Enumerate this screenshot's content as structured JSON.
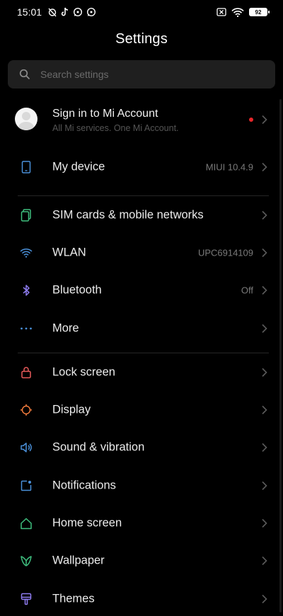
{
  "status_bar": {
    "time": "15:01",
    "battery_level": "92"
  },
  "header": {
    "title": "Settings"
  },
  "search": {
    "placeholder": "Search settings"
  },
  "account": {
    "title": "Sign in to Mi Account",
    "subtitle": "All Mi services. One Mi Account."
  },
  "items": [
    {
      "label": "My device",
      "value": "MIUI 10.4.9",
      "icon": "phone-icon",
      "color": "#4a90d9"
    },
    {
      "label": "SIM cards & mobile networks",
      "value": "",
      "icon": "sim-card-icon",
      "color": "#3fbf7f"
    },
    {
      "label": "WLAN",
      "value": "UPC6914109",
      "icon": "wifi-icon",
      "color": "#4a90d9"
    },
    {
      "label": "Bluetooth",
      "value": "Off",
      "icon": "bluetooth-icon",
      "color": "#8e7cf0"
    },
    {
      "label": "More",
      "value": "",
      "icon": "more-dots-icon",
      "color": "#4a90d9"
    },
    {
      "label": "Lock screen",
      "value": "",
      "icon": "lock-icon",
      "color": "#e85a5a"
    },
    {
      "label": "Display",
      "value": "",
      "icon": "display-sun-icon",
      "color": "#f07a3c"
    },
    {
      "label": "Sound & vibration",
      "value": "",
      "icon": "speaker-icon",
      "color": "#4a90d9"
    },
    {
      "label": "Notifications",
      "value": "",
      "icon": "notification-icon",
      "color": "#4a90d9"
    },
    {
      "label": "Home screen",
      "value": "",
      "icon": "home-icon",
      "color": "#3fbf7f"
    },
    {
      "label": "Wallpaper",
      "value": "",
      "icon": "wallpaper-flower-icon",
      "color": "#3fbf7f"
    },
    {
      "label": "Themes",
      "value": "",
      "icon": "themes-icon",
      "color": "#8e7cf0"
    }
  ]
}
